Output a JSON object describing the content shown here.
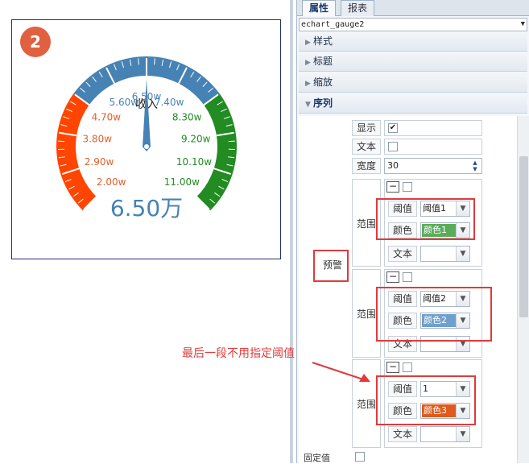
{
  "gauge": {
    "badge_number": "2",
    "series_name": "收入",
    "value_text": "6.50万",
    "value": 6.5,
    "min": 2,
    "max": 11,
    "tick_labels": [
      "2.00w",
      "2.90w",
      "3.80w",
      "4.70w",
      "5.60w",
      "6.50w",
      "7.40w",
      "8.30w",
      "9.20w",
      "10.10w",
      "11.00w"
    ],
    "tick_values": [
      2.0,
      2.9,
      3.8,
      4.7,
      5.6,
      6.5,
      7.4,
      8.3,
      9.2,
      10.1,
      11.0
    ],
    "bands": [
      {
        "to": 0.3,
        "color": "#ff4500"
      },
      {
        "to": 0.7,
        "color": "#4682b4"
      },
      {
        "to": 1.0,
        "color": "#228b22"
      }
    ],
    "label_colors": [
      "#e0602a",
      "#e0602a",
      "#e0602a",
      "#e0602a",
      "#4682b4",
      "#4682b4",
      "#4682b4",
      "#228b22",
      "#228b22",
      "#228b22",
      "#228b22"
    ],
    "value_color": "#4682b4",
    "pointer_color": "#4682b4"
  },
  "panel": {
    "tabs": [
      {
        "label": "属性"
      },
      {
        "label": "报表"
      }
    ],
    "component_select": "echart_gauge2",
    "sections": [
      {
        "label": "样式"
      },
      {
        "label": "标题"
      },
      {
        "label": "缩放"
      },
      {
        "label": "序列"
      }
    ],
    "rows": {
      "show_label": "显示",
      "text_label": "文本",
      "width_label": "宽度",
      "width_value": "30",
      "warning_label": "预警",
      "range_label": "范围",
      "threshold_label": "阈值",
      "color_label": "颜色",
      "text2_label": "文本",
      "fixed_value_label": "固定值"
    },
    "ranges": [
      {
        "threshold": "阈值1",
        "color_name": "颜色1",
        "color": "#5aac5a"
      },
      {
        "threshold": "阈值2",
        "color_name": "颜色2",
        "color": "#6f9fcc"
      },
      {
        "threshold": "1",
        "color_name": "颜色3",
        "color": "#e05a1e"
      }
    ],
    "annotation": "最后一段不用指定阈值",
    "show_checked": true
  }
}
